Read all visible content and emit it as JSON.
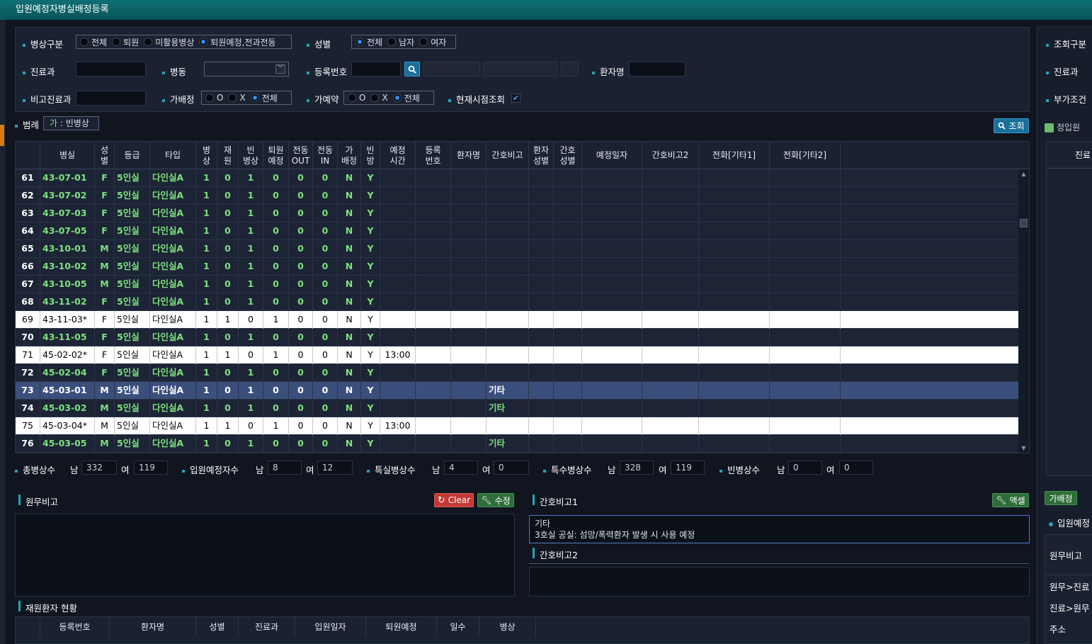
{
  "window_title": "입원예정자병실배정등록",
  "filters": {
    "bed_type_label": "병상구분",
    "bed_type_options": [
      "전체",
      "퇴원",
      "미활용병상",
      "퇴원예정,전과전동"
    ],
    "bed_type_selected": "퇴원예정,전과전동",
    "sex_label": "성별",
    "sex_options": [
      "전체",
      "남자",
      "여자"
    ],
    "sex_selected": "전체",
    "dept_label": "진료과",
    "ward_label": "병동",
    "reg_no_label": "등록번호",
    "patient_name_label": "환자명",
    "note_dept_label": "비고진료과",
    "temp_assign_label": "가배정",
    "temp_assign_options": [
      "O",
      "X",
      "전체"
    ],
    "temp_assign_selected": "전체",
    "temp_reserve_label": "가예약",
    "temp_reserve_options": [
      "O",
      "X",
      "전체"
    ],
    "temp_reserve_selected": "전체",
    "current_time_label": "현재시점조회",
    "current_time_checked": true,
    "legend_label": "범례",
    "legend_badge": "가",
    "legend_text": ": 빈병상",
    "search_button": "조회"
  },
  "grid": {
    "columns": [
      "",
      "병실",
      "성별",
      "등급",
      "타입",
      "병상",
      "재원",
      "빈병상",
      "퇴원예정",
      "전동OUT",
      "전동IN",
      "가배정",
      "빈방",
      "예정시간",
      "등록번호",
      "환자명",
      "간호비고",
      "환자성별",
      "간호성별",
      "예정일자",
      "간호비고2",
      "전화[기타1]",
      "전화[기타2]"
    ],
    "header_lines": [
      [
        ""
      ],
      [
        "병실"
      ],
      [
        "성",
        "별"
      ],
      [
        "등급"
      ],
      [
        "타입"
      ],
      [
        "병",
        "상"
      ],
      [
        "재",
        "원"
      ],
      [
        "빈",
        "병상"
      ],
      [
        "퇴원",
        "예정"
      ],
      [
        "전동",
        "OUT"
      ],
      [
        "전동",
        "IN"
      ],
      [
        "가",
        "배정"
      ],
      [
        "빈",
        "방"
      ],
      [
        "예정",
        "시간"
      ],
      [
        "등록",
        "번호"
      ],
      [
        "환자명"
      ],
      [
        "간호비고"
      ],
      [
        "환자",
        "성별"
      ],
      [
        "간호",
        "성별"
      ],
      [
        "예정일자"
      ],
      [
        "간호비고2"
      ],
      [
        "전화[기타1]"
      ],
      [
        "전화[기타2]"
      ]
    ],
    "rows": [
      {
        "no": "61",
        "room": "43-07-01",
        "sex": "F",
        "grade": "5인실",
        "type": "다인실A",
        "bed": "1",
        "stay": "0",
        "empty": "1",
        "discharge": "0",
        "out": "0",
        "in": "0",
        "temp": "N",
        "empty_room": "Y",
        "time": "",
        "note": "",
        "style": "dark"
      },
      {
        "no": "62",
        "room": "43-07-02",
        "sex": "F",
        "grade": "5인실",
        "type": "다인실A",
        "bed": "1",
        "stay": "0",
        "empty": "1",
        "discharge": "0",
        "out": "0",
        "in": "0",
        "temp": "N",
        "empty_room": "Y",
        "time": "",
        "note": "",
        "style": "dark"
      },
      {
        "no": "63",
        "room": "43-07-03",
        "sex": "F",
        "grade": "5인실",
        "type": "다인실A",
        "bed": "1",
        "stay": "0",
        "empty": "1",
        "discharge": "0",
        "out": "0",
        "in": "0",
        "temp": "N",
        "empty_room": "Y",
        "time": "",
        "note": "",
        "style": "dark"
      },
      {
        "no": "64",
        "room": "43-07-05",
        "sex": "F",
        "grade": "5인실",
        "type": "다인실A",
        "bed": "1",
        "stay": "0",
        "empty": "1",
        "discharge": "0",
        "out": "0",
        "in": "0",
        "temp": "N",
        "empty_room": "Y",
        "time": "",
        "note": "",
        "style": "dark"
      },
      {
        "no": "65",
        "room": "43-10-01",
        "sex": "M",
        "grade": "5인실",
        "type": "다인실A",
        "bed": "1",
        "stay": "0",
        "empty": "1",
        "discharge": "0",
        "out": "0",
        "in": "0",
        "temp": "N",
        "empty_room": "Y",
        "time": "",
        "note": "",
        "style": "dark"
      },
      {
        "no": "66",
        "room": "43-10-02",
        "sex": "M",
        "grade": "5인실",
        "type": "다인실A",
        "bed": "1",
        "stay": "0",
        "empty": "1",
        "discharge": "0",
        "out": "0",
        "in": "0",
        "temp": "N",
        "empty_room": "Y",
        "time": "",
        "note": "",
        "style": "dark"
      },
      {
        "no": "67",
        "room": "43-10-05",
        "sex": "M",
        "grade": "5인실",
        "type": "다인실A",
        "bed": "1",
        "stay": "0",
        "empty": "1",
        "discharge": "0",
        "out": "0",
        "in": "0",
        "temp": "N",
        "empty_room": "Y",
        "time": "",
        "note": "",
        "style": "dark"
      },
      {
        "no": "68",
        "room": "43-11-02",
        "sex": "F",
        "grade": "5인실",
        "type": "다인실A",
        "bed": "1",
        "stay": "0",
        "empty": "1",
        "discharge": "0",
        "out": "0",
        "in": "0",
        "temp": "N",
        "empty_room": "Y",
        "time": "",
        "note": "",
        "style": "dark"
      },
      {
        "no": "69",
        "room": "43-11-03*",
        "sex": "F",
        "grade": "5인실",
        "type": "다인실A",
        "bed": "1",
        "stay": "1",
        "empty": "0",
        "discharge": "1",
        "out": "0",
        "in": "0",
        "temp": "N",
        "empty_room": "Y",
        "time": "",
        "note": "",
        "style": "white"
      },
      {
        "no": "70",
        "room": "43-11-05",
        "sex": "F",
        "grade": "5인실",
        "type": "다인실A",
        "bed": "1",
        "stay": "0",
        "empty": "1",
        "discharge": "0",
        "out": "0",
        "in": "0",
        "temp": "N",
        "empty_room": "Y",
        "time": "",
        "note": "",
        "style": "dark"
      },
      {
        "no": "71",
        "room": "45-02-02*",
        "sex": "F",
        "grade": "5인실",
        "type": "다인실A",
        "bed": "1",
        "stay": "1",
        "empty": "0",
        "discharge": "1",
        "out": "0",
        "in": "0",
        "temp": "N",
        "empty_room": "Y",
        "time": "13:00",
        "note": "",
        "style": "white"
      },
      {
        "no": "72",
        "room": "45-02-04",
        "sex": "F",
        "grade": "5인실",
        "type": "다인실A",
        "bed": "1",
        "stay": "0",
        "empty": "1",
        "discharge": "0",
        "out": "0",
        "in": "0",
        "temp": "N",
        "empty_room": "Y",
        "time": "",
        "note": "",
        "style": "dark"
      },
      {
        "no": "73",
        "room": "45-03-01",
        "sex": "M",
        "grade": "5인실",
        "type": "다인실A",
        "bed": "1",
        "stay": "0",
        "empty": "1",
        "discharge": "0",
        "out": "0",
        "in": "0",
        "temp": "N",
        "empty_room": "Y",
        "time": "",
        "note": "기타",
        "style": "sel"
      },
      {
        "no": "74",
        "room": "45-03-02",
        "sex": "M",
        "grade": "5인실",
        "type": "다인실A",
        "bed": "1",
        "stay": "0",
        "empty": "1",
        "discharge": "0",
        "out": "0",
        "in": "0",
        "temp": "N",
        "empty_room": "Y",
        "time": "",
        "note": "기타",
        "style": "dark"
      },
      {
        "no": "75",
        "room": "45-03-04*",
        "sex": "M",
        "grade": "5인실",
        "type": "다인실A",
        "bed": "1",
        "stay": "1",
        "empty": "0",
        "discharge": "1",
        "out": "0",
        "in": "0",
        "temp": "N",
        "empty_room": "Y",
        "time": "13:00",
        "note": "",
        "style": "white"
      },
      {
        "no": "76",
        "room": "45-03-05",
        "sex": "M",
        "grade": "5인실",
        "type": "다인실A",
        "bed": "1",
        "stay": "0",
        "empty": "1",
        "discharge": "0",
        "out": "0",
        "in": "0",
        "temp": "N",
        "empty_room": "Y",
        "time": "",
        "note": "기타",
        "style": "dark"
      }
    ]
  },
  "stats": {
    "total_label": "총병상수",
    "total_m": "332",
    "total_f": "119",
    "admit_label": "입원예정자수",
    "admit_m": "8",
    "admit_f": "12",
    "special_label": "특실병상수",
    "special_m": "4",
    "special_f": "0",
    "special2_label": "특수병상수",
    "special2_m": "328",
    "special2_f": "119",
    "empty_label": "빈병상수",
    "empty_m": "0",
    "empty_f": "0",
    "male": "남",
    "female": "여"
  },
  "office_note": {
    "title": "원무비고",
    "clear_button": "Clear",
    "edit_button": "수정"
  },
  "nurse_note1": {
    "title": "간호비고1",
    "excel_button": "액셀",
    "line1": "기타",
    "line2": "3호실 공실: 섬망/폭력환자 발생 시 사용 예정"
  },
  "nurse_note2": {
    "title": "간호비고2"
  },
  "inpatient": {
    "title": "재원환자 현황",
    "columns": [
      "등록번호",
      "환자명",
      "성별",
      "진료과",
      "입원일자",
      "퇴원예정",
      "일수",
      "병상"
    ]
  },
  "right_panel": {
    "query_type": "조회구분",
    "dept": "진료과",
    "extra": "부가조건",
    "regular": "정입원",
    "dept2": "진료",
    "temp_btn": "가배정",
    "admit_scheduled": "입원예정",
    "office_note": "원무비고",
    "office_to_dept": "원무>진료",
    "dept_to_office": "진료>원무",
    "address": "주소"
  }
}
